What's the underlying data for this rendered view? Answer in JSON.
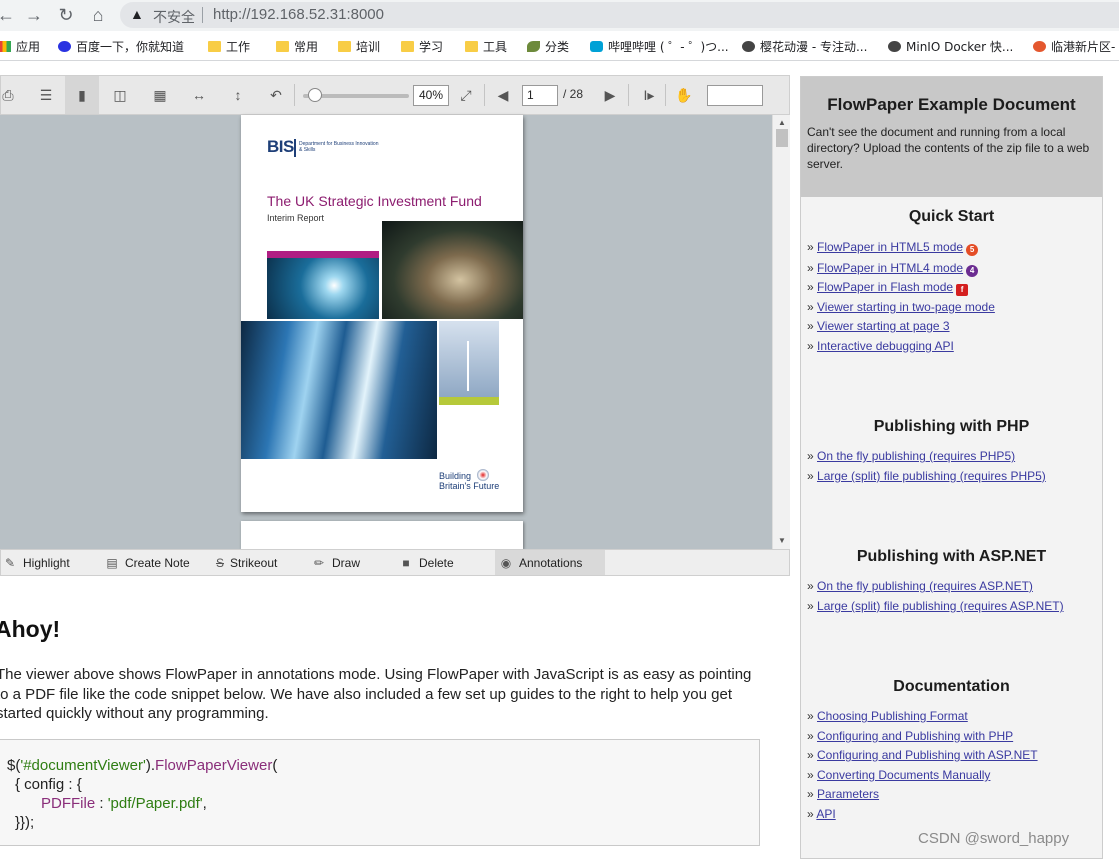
{
  "browser": {
    "security_label": "不安全",
    "url": "http://192.168.52.31:8000"
  },
  "bookmarks": [
    {
      "label": "应用",
      "icon": "apps-grid-icon"
    },
    {
      "label": "百度一下，你就知道",
      "icon": "baidu-icon"
    },
    {
      "label": "工作",
      "icon": "folder-icon"
    },
    {
      "label": "常用",
      "icon": "folder-icon"
    },
    {
      "label": "培训",
      "icon": "folder-icon"
    },
    {
      "label": "学习",
      "icon": "folder-icon"
    },
    {
      "label": "工具",
      "icon": "folder-icon"
    },
    {
      "label": "分类",
      "icon": "leaf-icon"
    },
    {
      "label": "哔哩哔哩 ( ゜- ゜)つ...",
      "icon": "bilibili-icon"
    },
    {
      "label": "樱花动漫 - 专注动...",
      "icon": "globe-icon"
    },
    {
      "label": "MinIO Docker 快...",
      "icon": "globe-icon"
    },
    {
      "label": "临港新片区-",
      "icon": "lingang-icon"
    }
  ],
  "viewer": {
    "zoom": "40%",
    "page": "1",
    "page_total": "/ 28"
  },
  "pdf": {
    "logo": "BIS",
    "department": "Department for Business Innovation & Skills",
    "title": "The UK Strategic Investment Fund",
    "subtitle": "Interim Report",
    "tagline_1": "Building",
    "tagline_2": "Britain's Future"
  },
  "annotations": {
    "highlight": "Highlight",
    "create_note": "Create Note",
    "strikeout": "Strikeout",
    "draw": "Draw",
    "delete": "Delete",
    "annotations": "Annotations"
  },
  "article": {
    "heading": "Ahoy!",
    "intro": "The viewer above shows FlowPaper in annotations mode. Using FlowPaper with JavaScript is as easy as pointing to a PDF file like the code snippet below. We have also included a few set up guides to the right to help you get started quickly without any programming.",
    "code": {
      "l1a": "$(",
      "l1b": "'#documentViewer'",
      "l1c": ").",
      "l1d": "FlowPaperViewer",
      "l1e": "(",
      "l2": "{ config : {",
      "l3a": "PDFFile",
      "l3b": " : ",
      "l3c": "'pdf/Paper.pdf'",
      "l3d": ",",
      "l4": "}});"
    }
  },
  "side": {
    "title": "FlowPaper Example Document",
    "desc": "Can't see the document and running from a local directory? Upload the contents of the zip file to a web server.",
    "quick_start": {
      "title": "Quick Start",
      "links": [
        "FlowPaper in HTML5 mode",
        "FlowPaper in HTML4 mode",
        "FlowPaper in Flash mode",
        "Viewer starting in two-page mode",
        "Viewer starting at page 3",
        "Interactive debugging API"
      ]
    },
    "php": {
      "title": "Publishing with PHP",
      "links": [
        "On the fly publishing (requires PHP5)",
        "Large (split) file publishing (requires PHP5)"
      ]
    },
    "aspnet": {
      "title": "Publishing with ASP.NET",
      "links": [
        "On the fly publishing (requires ASP.NET)",
        "Large (split) file publishing (requires ASP.NET)"
      ]
    },
    "docs": {
      "title": "Documentation",
      "links": [
        "Choosing Publishing Format",
        "Configuring and Publishing with PHP",
        "Configuring and Publishing with ASP.NET",
        "Converting Documents Manually",
        "Parameters",
        "API"
      ]
    }
  },
  "watermark": "CSDN @sword_happy"
}
